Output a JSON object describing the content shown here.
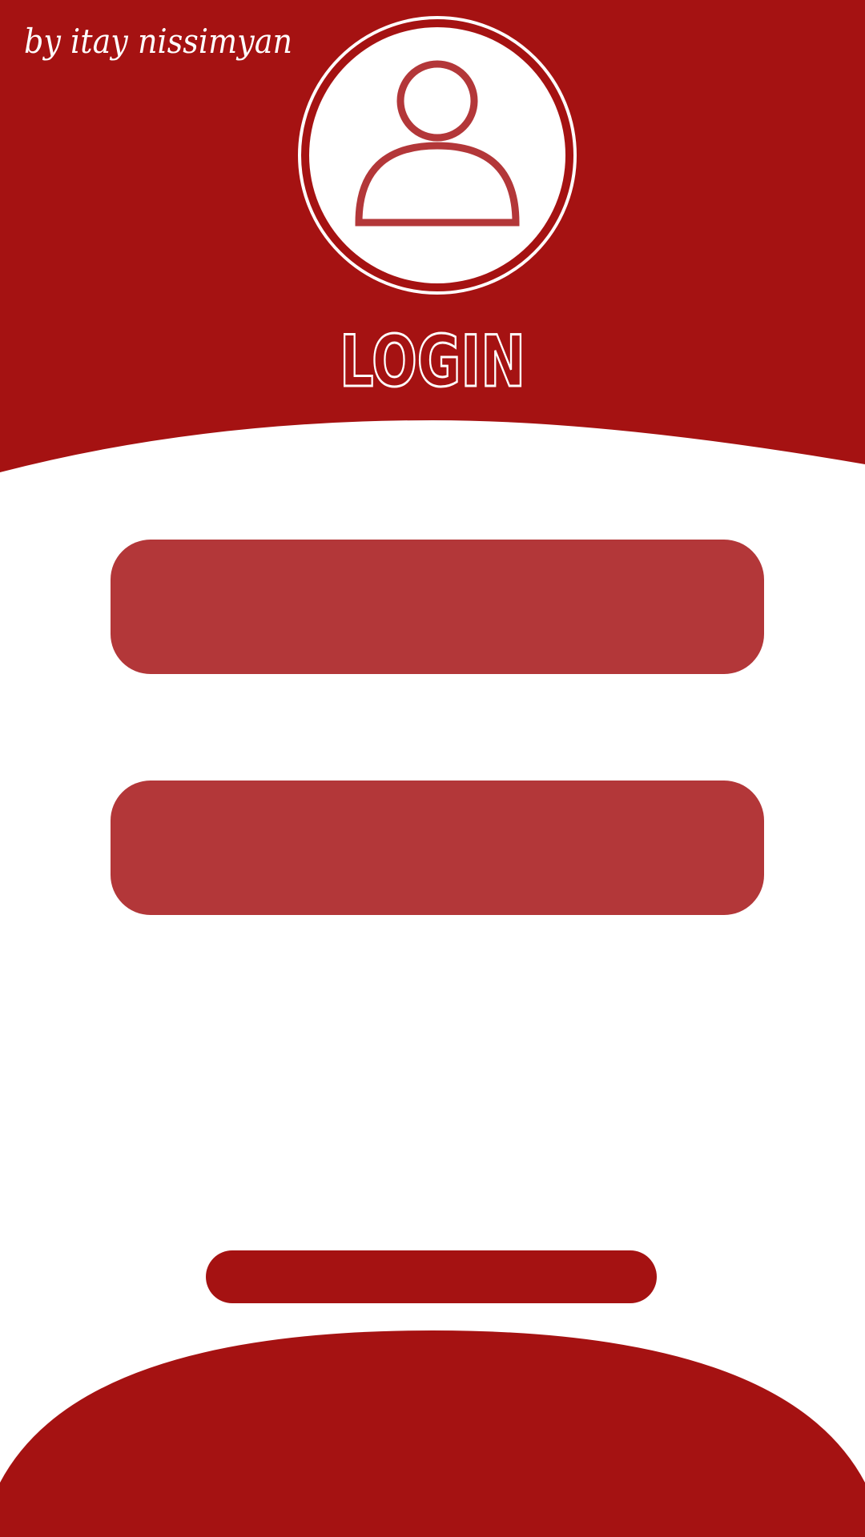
{
  "brand": {
    "signature": "by itay nissimyan",
    "primary_color": "#a51212",
    "field_color": "#b33739",
    "accent_color": "#ffffff"
  },
  "header": {
    "title": "LOGIN",
    "avatar_icon": "user-profile-icon"
  },
  "form": {
    "username": {
      "value": "",
      "placeholder": ""
    },
    "password": {
      "value": "",
      "placeholder": ""
    },
    "submit_label": ""
  }
}
